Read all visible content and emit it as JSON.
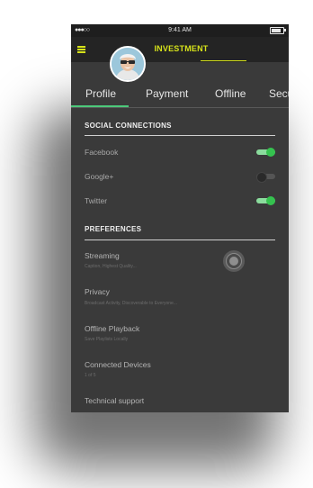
{
  "status_bar": {
    "signal": "●●●○○",
    "time": "9:41 AM"
  },
  "header": {
    "title": "INVESTMENT",
    "menu_icon": "hamburger-menu-icon",
    "avatar_icon": "user-avatar"
  },
  "tabs": [
    {
      "label": "Profile",
      "active": true
    },
    {
      "label": "Payment",
      "active": false
    },
    {
      "label": "Offline",
      "active": false
    },
    {
      "label": "Security",
      "active": false
    }
  ],
  "social": {
    "title": "SOCIAL CONNECTIONS",
    "items": [
      {
        "label": "Facebook",
        "enabled": true
      },
      {
        "label": "Google+",
        "enabled": false
      },
      {
        "label": "Twitter",
        "enabled": true
      }
    ]
  },
  "preferences": {
    "title": "PREFERENCES",
    "items": [
      {
        "label": "Streaming",
        "sub": "Caption, Highest Quality..."
      },
      {
        "label": "Privacy",
        "sub": "Broadcast Activity, Discoverable to Everyone..."
      },
      {
        "label": "Offline Playback",
        "sub": "Save Playlists Locally"
      },
      {
        "label": "Connected Devices",
        "sub": "1 of 5"
      },
      {
        "label": "Technical support",
        "sub": ""
      }
    ]
  },
  "colors": {
    "accent_yellow": "#d6e21a",
    "toggle_green": "#35c24f",
    "tab_underline": "#4cc97a",
    "background": "#3a3a3a"
  }
}
